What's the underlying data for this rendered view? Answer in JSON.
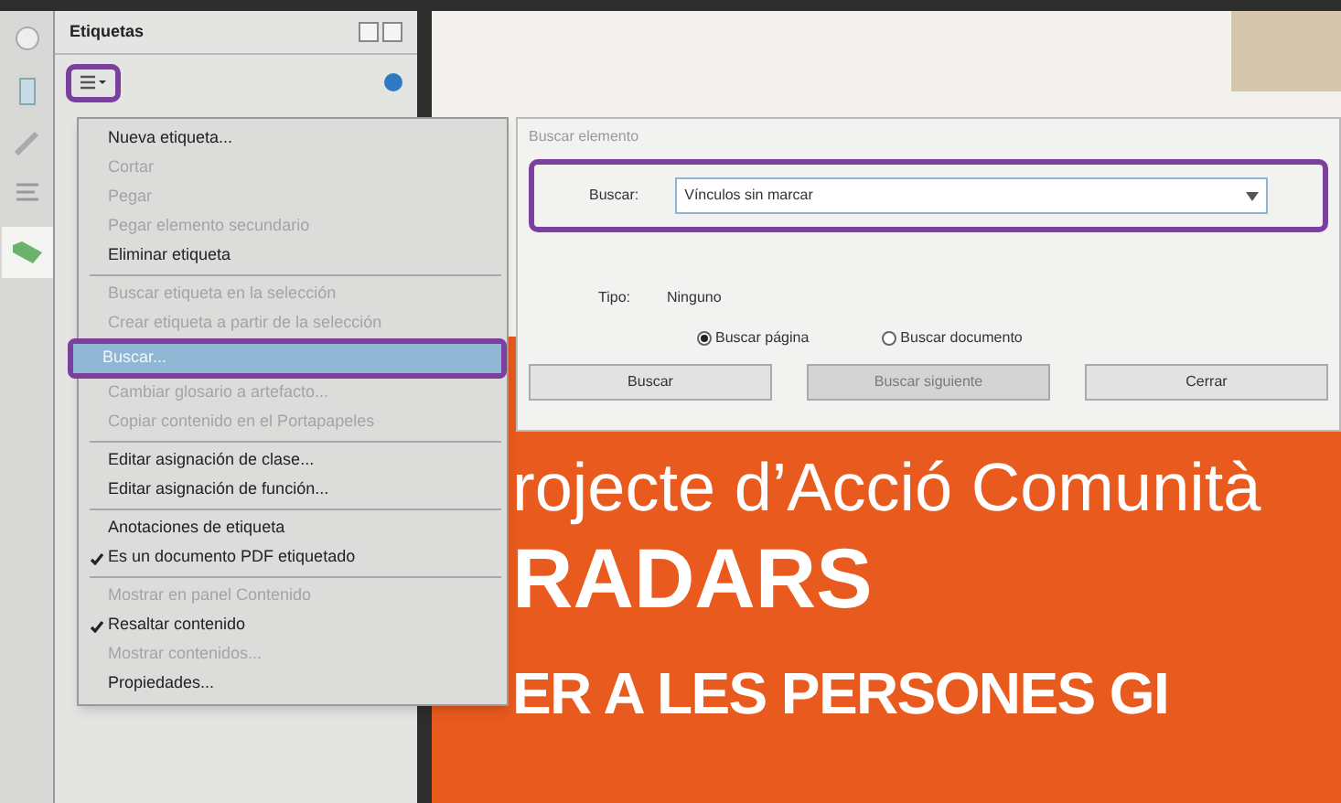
{
  "panel": {
    "title": "Etiquetas"
  },
  "menu": [
    {
      "kind": "item",
      "label": "Nueva etiqueta...",
      "disabled": false,
      "checked": false,
      "selected": false
    },
    {
      "kind": "item",
      "label": "Cortar",
      "disabled": true,
      "checked": false,
      "selected": false
    },
    {
      "kind": "item",
      "label": "Pegar",
      "disabled": true,
      "checked": false,
      "selected": false
    },
    {
      "kind": "item",
      "label": "Pegar elemento secundario",
      "disabled": true,
      "checked": false,
      "selected": false
    },
    {
      "kind": "item",
      "label": "Eliminar etiqueta",
      "disabled": false,
      "checked": false,
      "selected": false
    },
    {
      "kind": "separator"
    },
    {
      "kind": "item",
      "label": "Buscar etiqueta en la selección",
      "disabled": true,
      "checked": false,
      "selected": false
    },
    {
      "kind": "item",
      "label": "Crear etiqueta a partir de la selección",
      "disabled": true,
      "checked": false,
      "selected": false
    },
    {
      "kind": "item",
      "label": "Buscar...",
      "disabled": false,
      "checked": false,
      "selected": true
    },
    {
      "kind": "item",
      "label": "Cambiar glosario a artefacto...",
      "disabled": true,
      "checked": false,
      "selected": false
    },
    {
      "kind": "item",
      "label": "Copiar contenido en el Portapapeles",
      "disabled": true,
      "checked": false,
      "selected": false
    },
    {
      "kind": "separator"
    },
    {
      "kind": "item",
      "label": "Editar asignación de clase...",
      "disabled": false,
      "checked": false,
      "selected": false
    },
    {
      "kind": "item",
      "label": "Editar asignación de función...",
      "disabled": false,
      "checked": false,
      "selected": false
    },
    {
      "kind": "separator"
    },
    {
      "kind": "item",
      "label": "Anotaciones de etiqueta",
      "disabled": false,
      "checked": false,
      "selected": false
    },
    {
      "kind": "item",
      "label": "Es un documento PDF etiquetado",
      "disabled": false,
      "checked": true,
      "selected": false
    },
    {
      "kind": "separator"
    },
    {
      "kind": "item",
      "label": "Mostrar en panel Contenido",
      "disabled": true,
      "checked": false,
      "selected": false
    },
    {
      "kind": "item",
      "label": "Resaltar contenido",
      "disabled": false,
      "checked": true,
      "selected": false
    },
    {
      "kind": "item",
      "label": "Mostrar contenidos...",
      "disabled": true,
      "checked": false,
      "selected": false
    },
    {
      "kind": "item",
      "label": "Propiedades...",
      "disabled": false,
      "checked": false,
      "selected": false
    }
  ],
  "dialog": {
    "title": "Buscar elemento",
    "search_label": "Buscar:",
    "search_value": "Vínculos sin marcar",
    "type_label": "Tipo:",
    "type_value": "Ninguno",
    "radios": [
      {
        "label": "Buscar página",
        "selected": true
      },
      {
        "label": "Buscar documento",
        "selected": false
      }
    ],
    "buttons": [
      {
        "label": "Buscar",
        "disabled": false
      },
      {
        "label": "Buscar siguiente",
        "disabled": true
      },
      {
        "label": "Cerrar",
        "disabled": false
      }
    ]
  },
  "document": {
    "lines": [
      "rojecte d’Acció Comunità",
      "RADARS",
      "ER A LES PERSONES GI"
    ]
  }
}
